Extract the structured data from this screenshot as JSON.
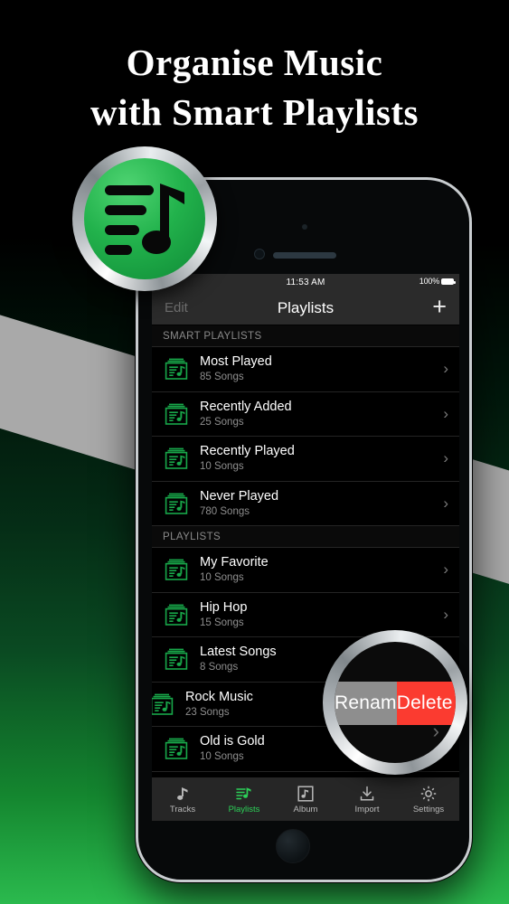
{
  "headline": {
    "line1": "Organise  Music",
    "line2": "with  Smart  Playlists"
  },
  "app_icon": {
    "name": "playlist-music-app-icon"
  },
  "colors": {
    "accent_green": "#2cd158",
    "icon_green": "#18a84a",
    "delete_red": "#fb3b30",
    "rename_grey": "#8e8e8e",
    "bg_bottom_green": "#2bba4e",
    "band_grey": "#a9a9a9"
  },
  "status_bar": {
    "time": "11:53 AM",
    "battery_percent": "100%",
    "battery_icon": "battery-full-icon"
  },
  "nav_bar": {
    "edit_label": "Edit",
    "title": "Playlists",
    "add_label": "+"
  },
  "sections": [
    {
      "header": "SMART PLAYLISTS",
      "rows": [
        {
          "title": "Most Played",
          "subtitle": "85 Songs",
          "chevron": "›",
          "swiped": false
        },
        {
          "title": "Recently Added",
          "subtitle": "25 Songs",
          "chevron": "›",
          "swiped": false
        },
        {
          "title": "Recently Played",
          "subtitle": "10 Songs",
          "chevron": "›",
          "swiped": false
        },
        {
          "title": "Never Played",
          "subtitle": "780 Songs",
          "chevron": "›",
          "swiped": false
        }
      ]
    },
    {
      "header": "PLAYLISTS",
      "rows": [
        {
          "title": "My Favorite",
          "subtitle": "10 Songs",
          "chevron": "›",
          "swiped": false
        },
        {
          "title": "Hip Hop",
          "subtitle": "15 Songs",
          "chevron": "›",
          "swiped": false
        },
        {
          "title": "Latest Songs",
          "subtitle": "8 Songs",
          "chevron": "›",
          "swiped": false
        },
        {
          "title": "Rock Music",
          "subtitle": "23 Songs",
          "chevron": "",
          "swiped": true
        },
        {
          "title": "Old is Gold",
          "subtitle": "10 Songs",
          "chevron": "›",
          "swiped": false
        }
      ]
    }
  ],
  "swipe_actions": {
    "rename_label": "Rename",
    "delete_label": "Delete"
  },
  "magnifier": {
    "rename_label": "Renam",
    "delete_label": "Delete",
    "chevron": "›"
  },
  "tab_bar": [
    {
      "label": "Tracks",
      "icon": "music-note-icon",
      "active": false
    },
    {
      "label": "Playlists",
      "icon": "playlist-icon",
      "active": true
    },
    {
      "label": "Album",
      "icon": "album-icon",
      "active": false
    },
    {
      "label": "Import",
      "icon": "download-arrow-icon",
      "active": false
    },
    {
      "label": "Settings",
      "icon": "gear-icon",
      "active": false
    }
  ]
}
